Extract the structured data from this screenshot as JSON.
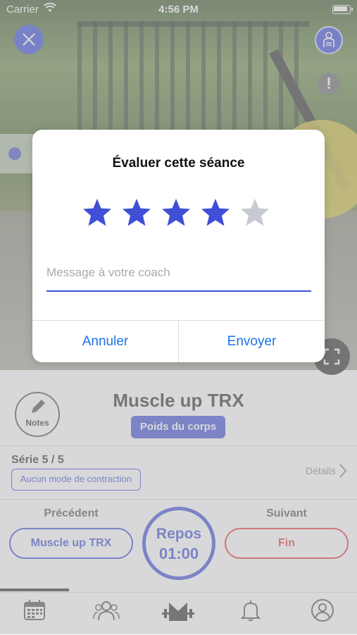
{
  "status_bar": {
    "carrier": "Carrier",
    "time": "4:56 PM"
  },
  "dialog": {
    "title": "Évaluer cette séance",
    "rating": 4,
    "max_rating": 5,
    "message_placeholder": "Message à votre coach",
    "cancel_label": "Annuler",
    "send_label": "Envoyer"
  },
  "exercise": {
    "notes_label": "Notes",
    "title": "Muscle up TRX",
    "tag": "Poids du corps",
    "serie": "Série 5 / 5",
    "contraction_mode": "Aucun mode de contraction",
    "details_label": "Détails"
  },
  "navigation": {
    "previous_label": "Précédent",
    "previous_exercise": "Muscle up TRX",
    "next_label": "Suivant",
    "next_exercise": "Fin",
    "rest_label": "Repos",
    "rest_time": "01:00"
  },
  "colors": {
    "accent": "#3f4fd6",
    "danger": "#e53935",
    "link": "#1a73e8",
    "star_off": "#c7cad1"
  },
  "tabbar": {
    "items": [
      "calendar-icon",
      "group-icon",
      "workout-icon",
      "bell-icon",
      "profile-icon"
    ],
    "active": "workout-icon"
  }
}
